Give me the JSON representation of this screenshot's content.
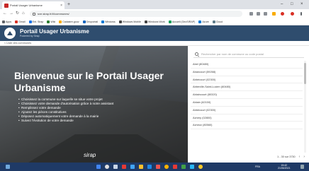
{
  "browser": {
    "tab_title": "Portail Usager Urbanisme",
    "tab_close": "×",
    "new_tab": "+",
    "window_controls": [
      "–",
      "□",
      "×"
    ],
    "nav": {
      "back": "←",
      "forward": "→",
      "reload": "↻",
      "home": "⌂"
    },
    "url": "sve.sirap.fr/#/communes/"
  },
  "bookmarks": [
    {
      "label": "Apps",
      "color": "#5f6368"
    },
    {
      "label": "Gmail",
      "color": "#d93025"
    },
    {
      "label": "Ent. Sirap",
      "color": "#1a73e8"
    },
    {
      "label": "Wiki",
      "color": "#2e7d32"
    },
    {
      "label": "Cadastre.gouv",
      "color": "#f9ab00"
    },
    {
      "label": "Géoportail",
      "color": "#1565c0"
    },
    {
      "label": "Windows",
      "color": "#0078d4"
    },
    {
      "label": "Windows Mobile",
      "color": "#444444"
    },
    {
      "label": "Windows Work",
      "color": "#444444"
    },
    {
      "label": "Accueil (GeoSIRAP)",
      "color": "#0f9d58"
    },
    {
      "label": "Azure",
      "color": "#0078d4"
    },
    {
      "label": "Cloud",
      "color": "#607d8b"
    }
  ],
  "header": {
    "title": "Portail Usager Urbanisme",
    "subtitle": "Powered by Sirap"
  },
  "links": {
    "communes": "< Liste des communes"
  },
  "hero": {
    "title": "Bienvenue sur le Portail Usager Urbanisme",
    "bullets": [
      "Choisissez la commune sur laquelle se situe votre projet",
      "Choisissez votre demande d'autorisation grâce à notre assistant",
      "Remplissez votre demande",
      "Ajoutez les pièces constitutives",
      "Déposez automatiquement votre demande à la mairie",
      "Suivez l'évolution de votre demande"
    ],
    "brand": "sirap"
  },
  "search": {
    "placeholder": "Rechercher par nom de commune ou code postal",
    "value": ""
  },
  "communes": [
    "Abel (80480)",
    "Abancourt (59268)",
    "Abbécourt (02300)",
    "Abbeville-Saint-Lucien (60480)",
    "Ablaincourt (80320)",
    "Ablain (62150)",
    "Abbécourt (02300)",
    "Achery (02800)",
    "Acheux (80560)"
  ],
  "pager": {
    "range": "1 - 30 sur 3730",
    "prev": "‹",
    "next": "›"
  },
  "taskbar": {
    "time": "15:42",
    "date": "21/06/2021",
    "lang": "FRA"
  }
}
